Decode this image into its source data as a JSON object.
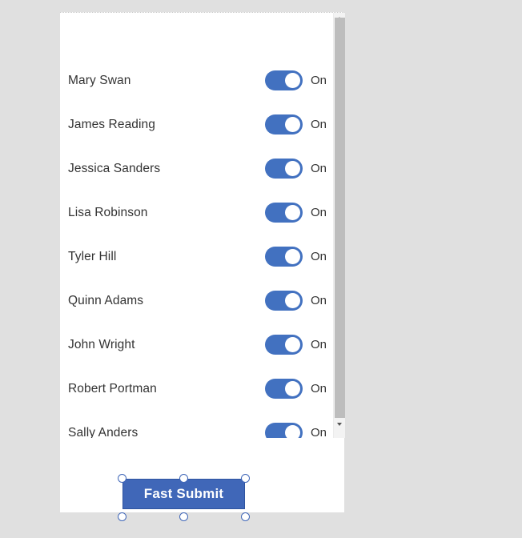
{
  "colors": {
    "page_background": "#e0e0e0",
    "card_background": "#ffffff",
    "toggle_on": "#4271c0",
    "button_blue": "#4067b8",
    "button_border": "#2f54a0",
    "scrollbar_track": "#f3f3f3",
    "scrollbar_thumb": "#bdbdbd",
    "text": "#333333"
  },
  "card": {
    "name": "toggle-list-form"
  },
  "list": {
    "rows": [
      {
        "label": "Mary Swan",
        "state": "On",
        "toggle": "on"
      },
      {
        "label": "James Reading",
        "state": "On",
        "toggle": "on"
      },
      {
        "label": "Jessica Sanders",
        "state": "On",
        "toggle": "on"
      },
      {
        "label": "Lisa Robinson",
        "state": "On",
        "toggle": "on"
      },
      {
        "label": "Tyler Hill",
        "state": "On",
        "toggle": "on"
      },
      {
        "label": "Quinn Adams",
        "state": "On",
        "toggle": "on"
      },
      {
        "label": "John Wright",
        "state": "On",
        "toggle": "on"
      },
      {
        "label": "Robert Portman",
        "state": "On",
        "toggle": "on"
      },
      {
        "label": "Sally Anders",
        "state": "On",
        "toggle": "on"
      }
    ]
  },
  "scrollbar": {
    "up_arrow_icon": "chevron-up-icon",
    "down_arrow_icon": "chevron-down-icon",
    "orientation": "vertical"
  },
  "submit": {
    "label": "Fast Submit",
    "selected": true,
    "handles": [
      "top-left",
      "top-center",
      "top-right",
      "bottom-left",
      "bottom-center",
      "bottom-right"
    ]
  }
}
